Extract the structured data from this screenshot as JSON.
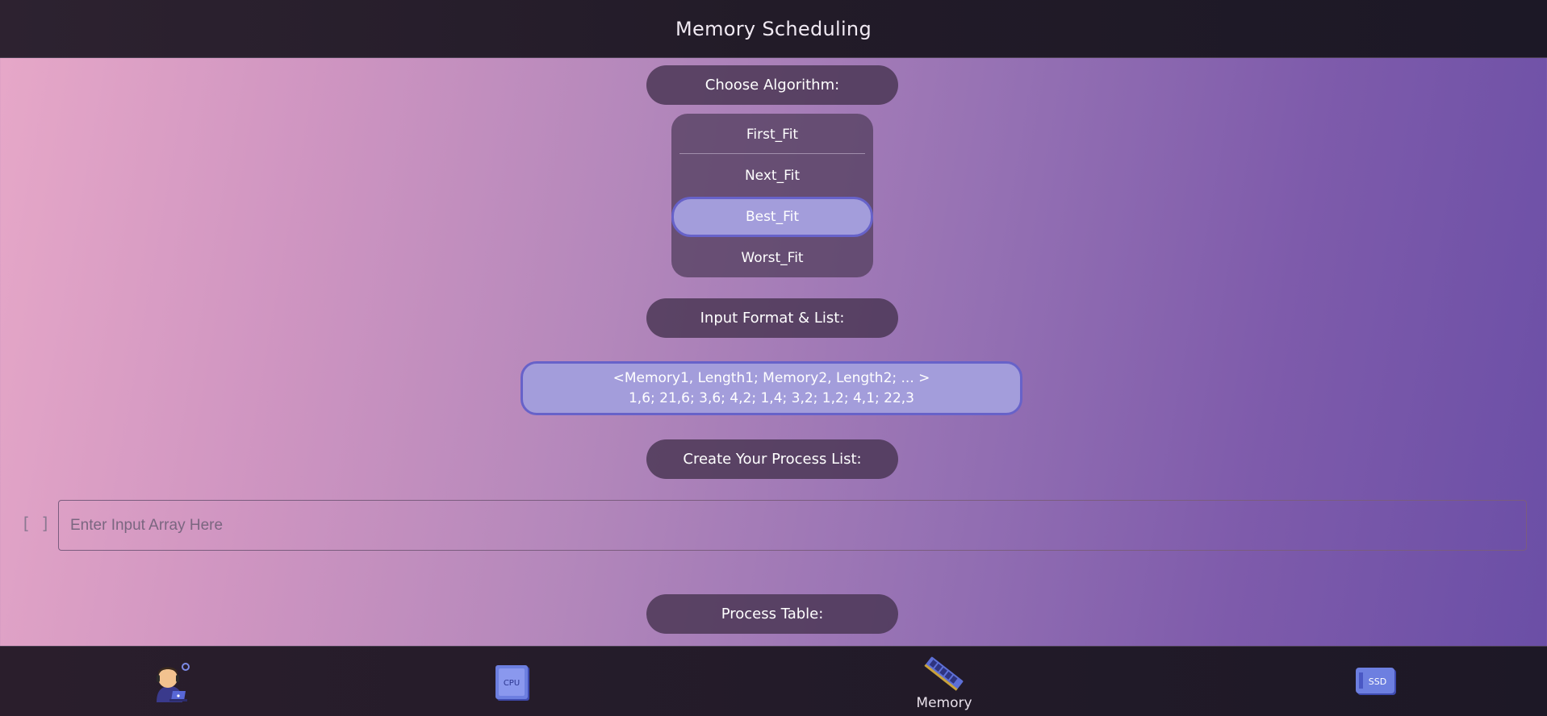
{
  "header": {
    "title": "Memory Scheduling"
  },
  "algorithm": {
    "heading": "Choose Algorithm:",
    "options": [
      "First_Fit",
      "Next_Fit",
      "Best_Fit",
      "Worst_Fit"
    ],
    "selected": "Best_Fit"
  },
  "format": {
    "heading": "Input Format & List:",
    "line1": "<Memory1, Length1; Memory2, Length2; ... >",
    "line2": "1,6; 21,6; 3,6; 4,2; 1,4; 3,2; 1,2; 4,1; 22,3"
  },
  "process_list": {
    "heading": "Create Your Process List:",
    "bracket_label": "[ ]",
    "placeholder": "Enter Input Array Here",
    "value": ""
  },
  "process_table": {
    "heading": "Process Table:"
  },
  "bottom_nav": {
    "items": [
      {
        "icon": "support-agent-icon",
        "label": ""
      },
      {
        "icon": "cpu-chip-icon",
        "label": "CPU"
      },
      {
        "icon": "memory-stick-icon",
        "label": "Memory"
      },
      {
        "icon": "ssd-drive-icon",
        "label": "SSD"
      }
    ],
    "active": "Memory"
  },
  "colors": {
    "selected_fill": "#a39ddb",
    "selected_border": "#6762c9",
    "pill_bg": "#483452",
    "bar_bg": "#221b28"
  }
}
